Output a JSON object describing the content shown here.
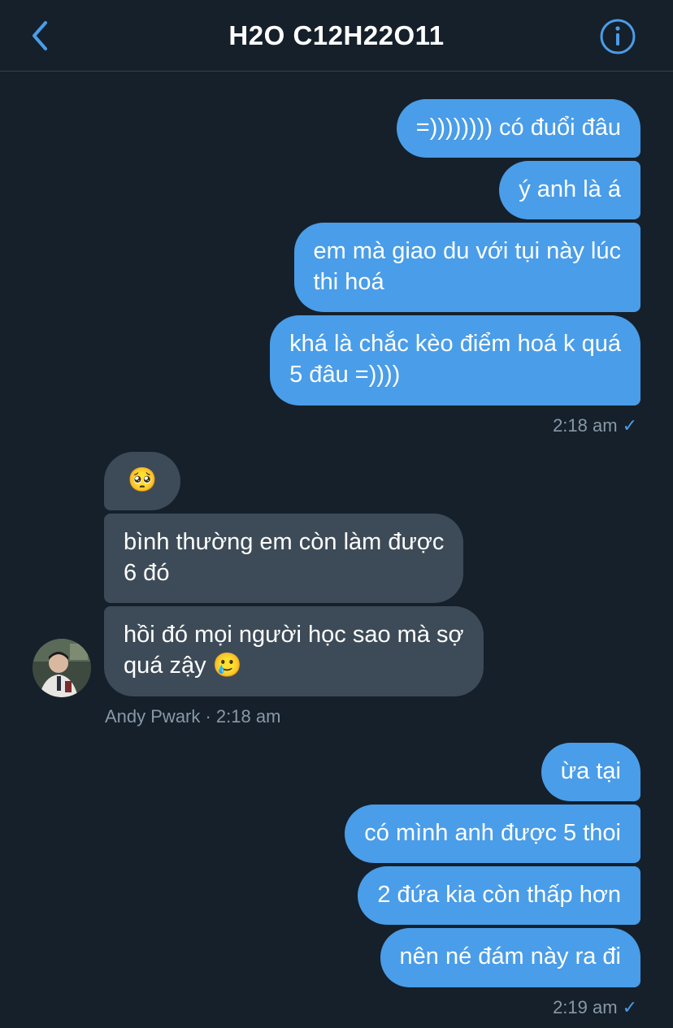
{
  "header": {
    "title": "H2O C12H22O11",
    "back_icon": "chevron-left-icon",
    "info_icon": "info-icon",
    "accent": "#4a9de8"
  },
  "messages": {
    "group1": [
      "=)))))))) có đuổi đâu",
      "ý anh là á",
      "em mà giao du với tụi này lúc",
      "thi hoá",
      "khá là chắc kèo điểm hoá k quá",
      "5 đâu =))))"
    ],
    "group1_time": "2:18 am",
    "group2": {
      "pleading_emoji": "🥺",
      "line1a": "bình thường em còn làm được",
      "line1b": "6 đó",
      "line2a": "hồi đó mọi người học sao mà sợ",
      "line2b": "quá zậy",
      "tear_emoji": "🥲"
    },
    "group2_meta": "Andy Pwark · 2:18 am",
    "group3": [
      "ừa tại",
      "có mình anh được 5 thoi",
      "2 đứa kia còn thấp hơn",
      "nên né đám này ra đi"
    ],
    "group3_time": "2:19 am",
    "check": "✓"
  },
  "colors": {
    "background": "#15202b",
    "outgoing_bubble": "#4a9de8",
    "incoming_bubble": "#3d4b58",
    "meta_text": "#8899a6"
  }
}
